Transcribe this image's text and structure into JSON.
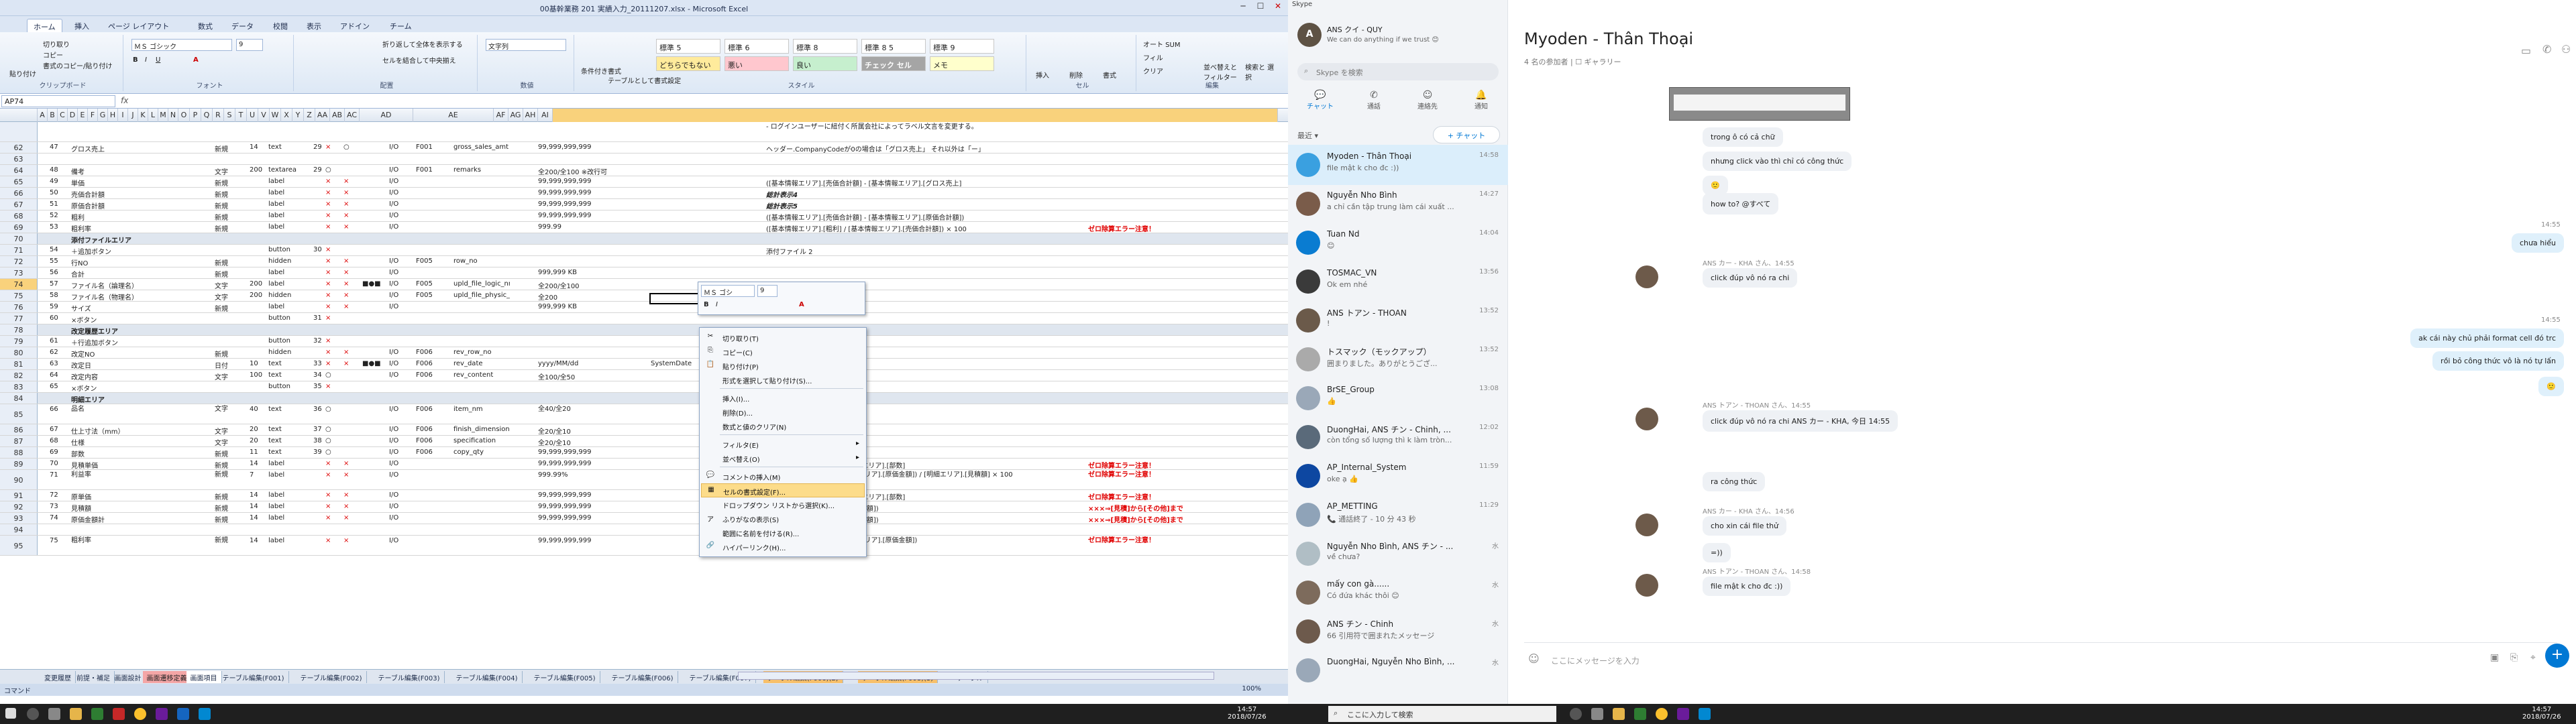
{
  "excel": {
    "title": "00基幹業務 201  実績入力_20111207.xlsx - Microsoft Excel",
    "tabs": [
      "ホーム",
      "挿入",
      "ページ レイアウト",
      "数式",
      "データ",
      "校閲",
      "表示",
      "アドイン",
      "チーム"
    ],
    "ribbon": {
      "paste": "貼り付け",
      "cut": "切り取り",
      "copy": "コピー",
      "format_painter": "書式のコピー/貼り付け",
      "clipboard": "クリップボード",
      "font_name": "ＭＳ ゴシック",
      "font_size": "9",
      "font_group": "フォント",
      "wrap": "折り返して全体を表示する",
      "merge": "セルを結合して中央揃え",
      "align_group": "配置",
      "number_format": "文字列",
      "number_group": "数値",
      "cond_format": "条件付き書式",
      "table_format": "テーブルとして書式設定",
      "styles": [
        "標準 5",
        "標準 6",
        "標準 8",
        "標準 8 5",
        "標準 9",
        "どちらでもない",
        "悪い",
        "良い",
        "チェック セル",
        "メモ"
      ],
      "style_group": "スタイル",
      "insert": "挿入",
      "delete": "削除",
      "format": "書式",
      "cells_group": "セル",
      "autosum": "オート SUM",
      "fill": "フィル",
      "clear": "クリア",
      "sort": "並べ替えと フィルター",
      "find": "検索と 選択",
      "edit_group": "編集"
    },
    "name_box": "AP74",
    "fx": "fx",
    "columns": [
      "A",
      "B",
      "C",
      "D",
      "E",
      "F",
      "G",
      "H",
      "I",
      "J",
      "K",
      "L",
      "M",
      "N",
      "O",
      "P",
      "Q",
      "R",
      "S",
      "T",
      "U",
      "V",
      "W",
      "X",
      "Y",
      "Z",
      "AA",
      "AB",
      "AC",
      "AD",
      "AE",
      "AF",
      "AG",
      "AH",
      "AI"
    ],
    "rows": [
      {
        "n": "",
        "tall": true,
        "c": [
          "",
          "",
          "",
          "",
          "",
          "",
          "",
          "",
          "",
          "",
          "",
          "",
          "",
          "",
          "",
          "",
          "",
          "",
          "",
          "",
          "- ログインユーザーに紐付く所属会社によってラベル文言を変更する。"
        ]
      },
      {
        "n": "62",
        "c": [
          "47",
          "グロス売上",
          "新規",
          "14",
          "text",
          "29",
          "×",
          "○",
          "",
          "I/O",
          "F001",
          "gross_sales_amt",
          "",
          "99,999,999,999",
          "",
          "ヘッダー.CompanyCodeが0の場合は「グロス売上」 それ以外は「ー」",
          ""
        ]
      },
      {
        "n": "63",
        "c": [
          "",
          "",
          "",
          "",
          "",
          "",
          "",
          "",
          "",
          "",
          "",
          "",
          "",
          "",
          "",
          "",
          ""
        ]
      },
      {
        "n": "64",
        "c": [
          "48",
          "備考",
          "文字",
          "200",
          "textarea",
          "29",
          "○",
          "",
          "",
          "I/O",
          "F001",
          "remarks",
          "",
          "全200/全100 ※改行可",
          "",
          "",
          ""
        ]
      },
      {
        "n": "65",
        "c": [
          "49",
          "単価",
          "新規",
          "",
          "label",
          "",
          "×",
          "×",
          "",
          "I/O",
          "",
          "",
          "",
          "99,999,999,999",
          "",
          "([基本情報エリア].[売価合計額] - [基本情報エリア].[グロス売上]",
          ""
        ]
      },
      {
        "n": "66",
        "c": [
          "50",
          "売価合計額",
          "新規",
          "",
          "label",
          "",
          "×",
          "×",
          "",
          "I/O",
          "",
          "",
          "",
          "99,999,999,999",
          "",
          "総計表示4",
          ""
        ]
      },
      {
        "n": "67",
        "c": [
          "51",
          "原価合計額",
          "新規",
          "",
          "label",
          "",
          "×",
          "×",
          "",
          "I/O",
          "",
          "",
          "",
          "99,999,999,999",
          "",
          "総計表示5",
          ""
        ]
      },
      {
        "n": "68",
        "c": [
          "52",
          "粗利",
          "新規",
          "",
          "label",
          "",
          "×",
          "×",
          "",
          "I/O",
          "",
          "",
          "",
          "99,999,999,999",
          "",
          "([基本情報エリア].[売価合計額] - [基本情報エリア].[原価合計額])",
          ""
        ]
      },
      {
        "n": "69",
        "c": [
          "53",
          "粗利率",
          "新規",
          "",
          "label",
          "",
          "×",
          "×",
          "",
          "I/O",
          "",
          "",
          "",
          "999.99",
          "",
          "([基本情報エリア].[粗利] / [基本情報エリア].[売価合計額]) × 100",
          "ゼロ除算エラー注意！"
        ]
      },
      {
        "n": "70",
        "sec": true,
        "c": [
          "",
          "添付ファイルエリア"
        ]
      },
      {
        "n": "71",
        "c": [
          "54",
          "＋追加ボタン",
          "",
          "",
          "button",
          "30",
          "×",
          "",
          "",
          "",
          "",
          "",
          "",
          "",
          "",
          "添付ファイル 2",
          ""
        ]
      },
      {
        "n": "72",
        "c": [
          "55",
          "行NO",
          "新規",
          "",
          "hidden",
          "",
          "×",
          "×",
          "",
          "I/O",
          "F005",
          "row_no",
          "",
          "",
          "",
          "",
          ""
        ]
      },
      {
        "n": "73",
        "c": [
          "56",
          "合計",
          "新規",
          "",
          "label",
          "",
          "×",
          "×",
          "",
          "I/O",
          "",
          "",
          "",
          "999,999 KB",
          "",
          "",
          ""
        ]
      },
      {
        "n": "74",
        "sel": true,
        "c": [
          "57",
          "ファイル名（論理名）",
          "文字",
          "200",
          "label",
          "",
          "×",
          "×",
          "■●■",
          "I/O",
          "F005",
          "upld_file_logic_nm",
          "",
          "全200/全100",
          "",
          "",
          ""
        ]
      },
      {
        "n": "75",
        "c": [
          "58",
          "ファイル名（物理名）",
          "文字",
          "200",
          "hidden",
          "",
          "×",
          "×",
          "",
          "I/O",
          "F005",
          "upld_file_physic_nm",
          "",
          "全200",
          "",
          "",
          ""
        ]
      },
      {
        "n": "76",
        "c": [
          "59",
          "サイズ",
          "新規",
          "",
          "label",
          "",
          "×",
          "×",
          "",
          "I/O",
          "",
          "",
          "",
          "999,999 KB",
          "",
          "",
          ""
        ]
      },
      {
        "n": "77",
        "c": [
          "60",
          "×ボタン",
          "",
          "",
          "button",
          "31",
          "×",
          "",
          "",
          "",
          "",
          "",
          "",
          "",
          "",
          "",
          ""
        ]
      },
      {
        "n": "78",
        "sec": true,
        "c": [
          "",
          "改定履歴エリア"
        ]
      },
      {
        "n": "79",
        "c": [
          "61",
          "＋行追加ボタン",
          "",
          "",
          "button",
          "32",
          "×",
          "",
          "",
          "",
          "",
          "",
          "",
          "",
          "",
          "",
          ""
        ]
      },
      {
        "n": "80",
        "c": [
          "62",
          "改定NO",
          "新規",
          "",
          "hidden",
          "",
          "×",
          "×",
          "",
          "I/O",
          "F006",
          "rev_row_no",
          "",
          "",
          "",
          "",
          ""
        ]
      },
      {
        "n": "81",
        "c": [
          "63",
          "改定日",
          "日付",
          "10",
          "text",
          "33",
          "×",
          "×",
          "■●■",
          "I/O",
          "F006",
          "rev_date",
          "",
          "yyyy/MM/dd",
          "SystemDate",
          "",
          ""
        ]
      },
      {
        "n": "82",
        "c": [
          "64",
          "改定内容",
          "文字",
          "100",
          "text",
          "34",
          "○",
          "",
          "",
          "I/O",
          "F006",
          "rev_content",
          "",
          "全100/全50",
          "",
          "",
          ""
        ]
      },
      {
        "n": "83",
        "c": [
          "65",
          "×ボタン",
          "",
          "",
          "button",
          "35",
          "×",
          "",
          "",
          "",
          "",
          "",
          "",
          "",
          "",
          "",
          ""
        ]
      },
      {
        "n": "84",
        "sec": true,
        "c": [
          "",
          "明細エリア"
        ]
      },
      {
        "n": "85",
        "tall": true,
        "c": [
          "66",
          "品名",
          "文字",
          "40",
          "text",
          "36",
          "○",
          "",
          "",
          "I/O",
          "F006",
          "item_nm",
          "",
          "全40/全20",
          "",
          "",
          ""
        ]
      },
      {
        "n": "86",
        "c": [
          "67",
          "仕上寸法（mm）",
          "文字",
          "20",
          "text",
          "37",
          "○",
          "",
          "",
          "I/O",
          "F006",
          "finish_dimension",
          "",
          "全20/全10",
          "",
          "",
          ""
        ]
      },
      {
        "n": "87",
        "c": [
          "68",
          "仕様",
          "文字",
          "20",
          "text",
          "38",
          "○",
          "",
          "",
          "I/O",
          "F006",
          "specification",
          "",
          "全20/全10",
          "",
          "",
          ""
        ]
      },
      {
        "n": "88",
        "c": [
          "69",
          "部数",
          "新規",
          "11",
          "text",
          "39",
          "○",
          "",
          "",
          "I/O",
          "F006",
          "copy_qty",
          "",
          "99,999,999,999",
          "",
          "",
          ""
        ]
      },
      {
        "n": "89",
        "c": [
          "70",
          "見積単価",
          "新規",
          "14",
          "label",
          "",
          "×",
          "×",
          "",
          "I/O",
          "",
          "",
          "",
          "99,999,999,999",
          "",
          "[明細エリア].[原価金額] / [明細エリア].[部数]",
          "ゼロ除算エラー注意！"
        ]
      },
      {
        "n": "90",
        "tall": true,
        "c": [
          "71",
          "利益率",
          "新規",
          "7",
          "label",
          "",
          "×",
          "×",
          "",
          "I/O",
          "",
          "",
          "",
          "999.99%",
          "",
          "([明細エリア].[見積額] - [明細エリア].[原価金額]) / [明細エリア].[見積額] × 100",
          "ゼロ除算エラー注意！"
        ]
      },
      {
        "n": "91",
        "c": [
          "72",
          "原単価",
          "新規",
          "14",
          "label",
          "",
          "×",
          "×",
          "",
          "I/O",
          "",
          "",
          "",
          "99,999,999,999",
          "",
          "[明細エリア].[原価金額] / [明細エリア].[部数]",
          "ゼロ除算エラー注意！"
        ]
      },
      {
        "n": "92",
        "c": [
          "73",
          "見積額",
          "新規",
          "14",
          "label",
          "",
          "×",
          "×",
          "",
          "I/O",
          "",
          "",
          "",
          "99,999,999,999",
          "",
          "SUM([明細エリア-×××].[見積金額])",
          "×××⇒[見積]から[その他]まで"
        ]
      },
      {
        "n": "93",
        "c": [
          "74",
          "原価金額計",
          "新規",
          "14",
          "label",
          "",
          "×",
          "×",
          "",
          "I/O",
          "",
          "",
          "",
          "99,999,999,999",
          "",
          "SUM([明細エリア-×××].[原価金額])",
          "×××⇒[見積]から[その他]まで"
        ]
      },
      {
        "n": "94",
        "c": [
          "",
          "",
          "",
          "",
          "",
          "",
          "",
          "",
          "",
          "",
          "",
          "",
          "",
          "",
          "",
          "",
          ""
        ]
      },
      {
        "n": "95",
        "tall": true,
        "c": [
          "75",
          "粗利率",
          "新規",
          "14",
          "label",
          "",
          "×",
          "×",
          "",
          "I/O",
          "",
          "",
          "",
          "99,999,999,999",
          "",
          "([明細エリア].[見積額] - [明細エリア].[原価金額])",
          "ゼロ除算エラー注意！"
        ]
      }
    ],
    "context_menu": [
      {
        "icon": "✂",
        "label": "切り取り(T)"
      },
      {
        "icon": "⎘",
        "label": "コピー(C)"
      },
      {
        "icon": "📋",
        "label": "貼り付け(P)"
      },
      {
        "icon": "",
        "label": "形式を選択して貼り付け(S)..."
      },
      {
        "sep": true
      },
      {
        "icon": "",
        "label": "挿入(I)..."
      },
      {
        "icon": "",
        "label": "削除(D)..."
      },
      {
        "icon": "",
        "label": "数式と値のクリア(N)"
      },
      {
        "sep": true
      },
      {
        "icon": "",
        "label": "フィルタ(E)",
        "sub": true
      },
      {
        "icon": "",
        "label": "並べ替え(O)",
        "sub": true
      },
      {
        "sep": true
      },
      {
        "icon": "💬",
        "label": "コメントの挿入(M)"
      },
      {
        "icon": "▦",
        "label": "セルの書式設定(F)...",
        "hl": true
      },
      {
        "icon": "",
        "label": "ドロップダウン リストから選択(K)..."
      },
      {
        "icon": "ア",
        "label": "ふりがなの表示(S)"
      },
      {
        "icon": "",
        "label": "範囲に名前を付ける(R)..."
      },
      {
        "icon": "🔗",
        "label": "ハイパーリンク(H)..."
      }
    ],
    "mini_toolbar": {
      "font": "ＭＳ ゴシ",
      "size": "9"
    },
    "sheets": [
      "変更履歴",
      "前提・補足",
      "画面設計",
      "画面遷移定義",
      "画面項目",
      "テーブル編集(F001)",
      "テーブル編集(F002)",
      "テーブル編集(F003)",
      "テーブル編集(F004)",
      "テーブル編集(F005)",
      "テーブル編集(F006)",
      "テーブル編集(F007)",
      "テーブル編集(F006)(2)",
      "テーブル編集(F008)(3)",
      "テーブル"
    ],
    "status": "コマンド",
    "zoom": "100%"
  },
  "skype": {
    "title": "Skype",
    "profile": {
      "name": "ANS クイ - QUY",
      "mood": "We can do anything if we trust 😊"
    },
    "search_placeholder": "Skype を検索",
    "nav": [
      "チャット",
      "通話",
      "連絡先",
      "通知"
    ],
    "recent_label": "最近 ▾",
    "new_chat": "+ チャット",
    "contacts": [
      {
        "name": "Myoden - Thân Thoại",
        "preview": "file mật k cho đc :))",
        "time": "14:58",
        "color": "#3aa0e0",
        "active": true
      },
      {
        "name": "Nguyễn Nho Bình",
        "preview": "a chỉ cần tập trung làm cái xuất ...",
        "time": "14:27",
        "color": "#7a5c4a"
      },
      {
        "name": "Tuan Nd",
        "preview": "😊",
        "time": "14:04",
        "color": "#0a7cd1"
      },
      {
        "name": "TOSMAC_VN",
        "preview": "Ok em nhé",
        "time": "13:56",
        "color": "#3a3a3a"
      },
      {
        "name": "ANS トアン - THOAN",
        "preview": "!",
        "time": "13:52",
        "color": "#6b5a4a"
      },
      {
        "name": "トスマック（モックアップ）",
        "preview": "囲まりました。ありがとうござ...",
        "time": "13:52",
        "color": "#aaaaaa"
      },
      {
        "name": "BrSE_Group",
        "preview": "👍",
        "time": "13:08",
        "color": "#9aa8b8"
      },
      {
        "name": "DuongHai, ANS チン - Chinh, ...",
        "preview": "còn tổng số lượng thì k làm tròn...",
        "time": "12:02",
        "color": "#5a6a7a"
      },
      {
        "name": "AP_Internal_System",
        "preview": "oke ạ 👍",
        "time": "11:59",
        "color": "#0d47a1"
      },
      {
        "name": "AP_METTING",
        "preview": "📞 通話終了 - 10 分 43 秒",
        "time": "11:29",
        "color": "#8fa3b8"
      },
      {
        "name": "Nguyễn Nho Bình, ANS チン - ...",
        "preview": "về chưa?",
        "time": "水",
        "color": "#b0bec5"
      },
      {
        "name": "mấy con gà......",
        "preview": "Có đứa khác thôi 😊",
        "time": "水",
        "color": "#7d6b5c"
      },
      {
        "name": "ANS チン - Chinh",
        "preview": "66 引用符で囲まれたメッセージ",
        "time": "水",
        "color": "#6d5a4c"
      },
      {
        "name": "DuongHai, Nguyễn Nho Bình, ...",
        "preview": "",
        "time": "水",
        "color": "#9aa8b8"
      }
    ],
    "chat_title": "Myoden -  Thân Thoại",
    "chat_sub": "4 名の参加者 | ☐ ギャラリー",
    "messages": [
      {
        "dir": "in",
        "text": "trong ô có cả chữ"
      },
      {
        "dir": "in",
        "text": "nhưng click vào thì chỉ có công thức"
      },
      {
        "dir": "in",
        "text": "🙂"
      },
      {
        "dir": "in",
        "text": "how to? @すべて"
      },
      {
        "dir": "out",
        "text": "chưa hiểu",
        "time": "14:55"
      },
      {
        "dir": "in",
        "text": "click đúp vô nó ra chi",
        "meta": "ANS カー - KHA さん、14:55"
      },
      {
        "dir": "out",
        "text": "ak cái này chủ phải format cell đó trc",
        "time": "14:55"
      },
      {
        "dir": "out",
        "text": "rồi bỏ công thức vô là nó tự lấn"
      },
      {
        "dir": "out",
        "text": "🙂"
      },
      {
        "dir": "in",
        "text": "click đúp vô nó ra chi  ANS カー - KHA, 今日 14:55",
        "meta": "ANS トアン - THOAN さん、14:55"
      },
      {
        "dir": "in",
        "text": "ra công thức"
      },
      {
        "dir": "in",
        "text": "cho xin cái file thử",
        "meta": "ANS カー - KHA さん、14:56"
      },
      {
        "dir": "in",
        "text": "=))"
      },
      {
        "dir": "in",
        "text": "file mật k cho đc :))",
        "meta": "ANS トアン - THOAN さん、14:58"
      }
    ],
    "input_placeholder": "ここにメッセージを入力",
    "clock": "14:57",
    "date": "2018/07/26"
  },
  "taskbar": {
    "search_placeholder": "ここに入力して検索",
    "clock_left": "14:57",
    "date_left": "2018/07/26",
    "clock_right": "14:57",
    "date_right": "2018/07/26"
  }
}
